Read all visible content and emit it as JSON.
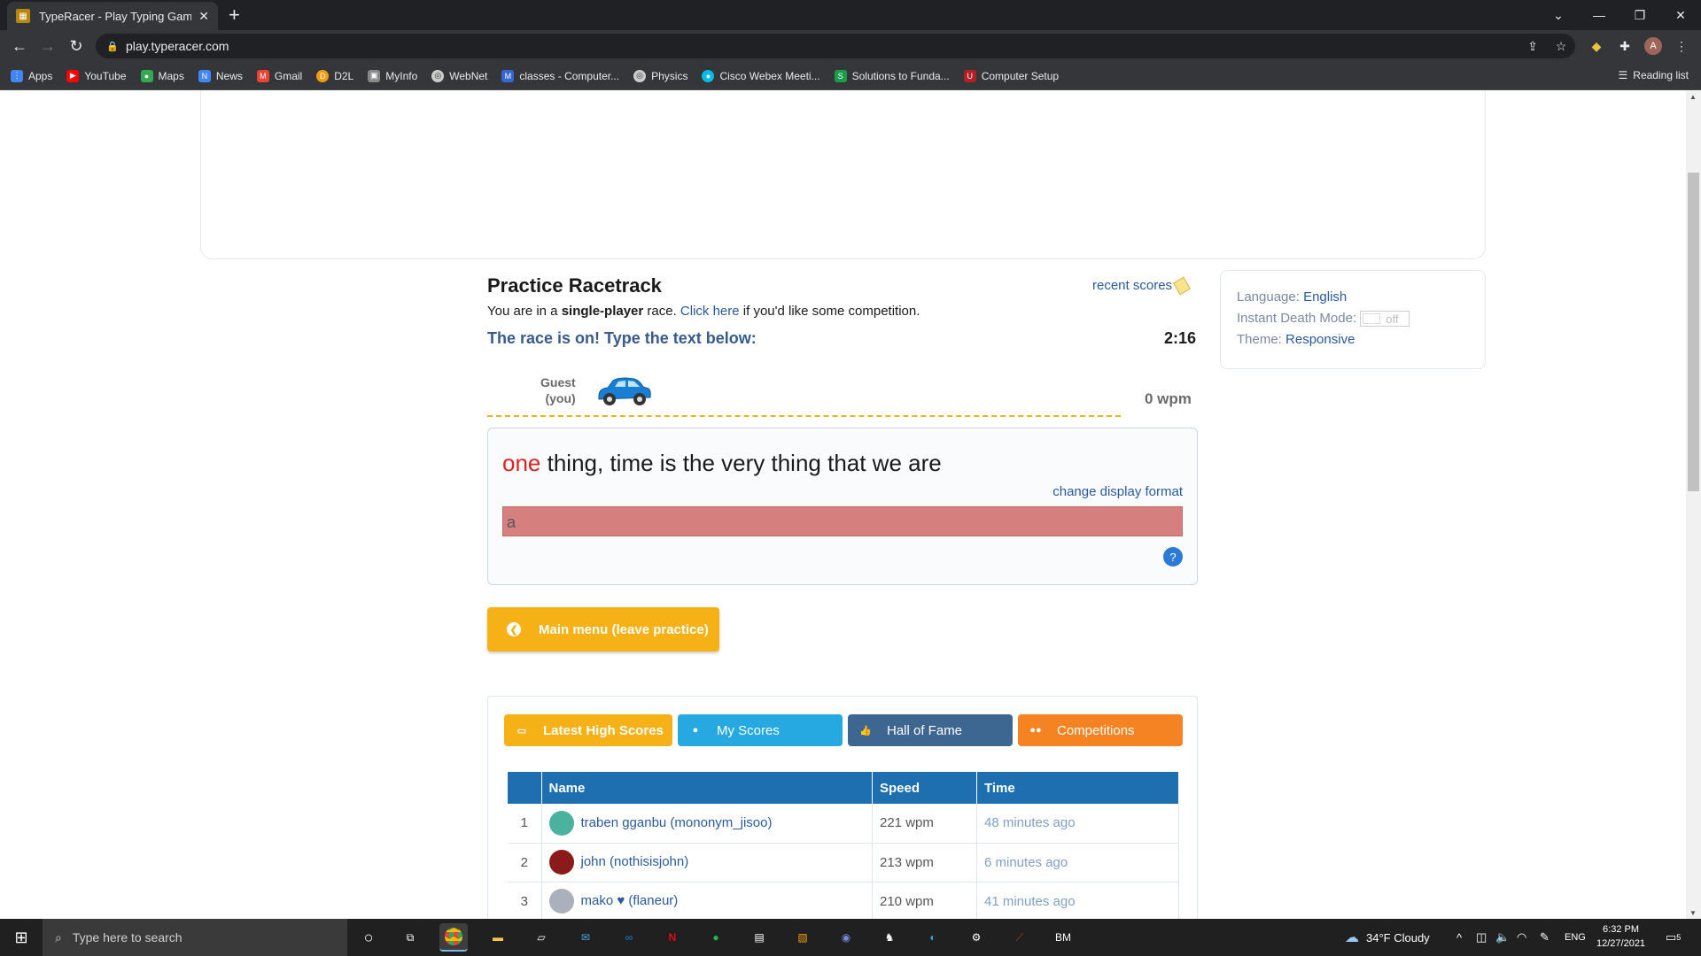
{
  "browser": {
    "tab_title": "TypeRacer - Play Typing Games a",
    "url": "play.typeracer.com",
    "bookmarks": [
      {
        "label": "Apps",
        "icon": "apps-grid-icon",
        "color": "#4285f4"
      },
      {
        "label": "YouTube",
        "icon": "youtube-icon",
        "color": "#ff0000"
      },
      {
        "label": "Maps",
        "icon": "maps-pin-icon",
        "color": "#34a853"
      },
      {
        "label": "News",
        "icon": "news-icon",
        "color": "#4285f4"
      },
      {
        "label": "Gmail",
        "icon": "gmail-icon",
        "color": "#ea4335"
      },
      {
        "label": "D2L",
        "icon": "d2l-icon",
        "color": "#f39c12"
      },
      {
        "label": "MyInfo",
        "icon": "myinfo-icon",
        "color": "#888888"
      },
      {
        "label": "WebNet",
        "icon": "webnet-icon",
        "color": "#cccccc"
      },
      {
        "label": "classes - Computer...",
        "icon": "classes-icon",
        "color": "#3367d6"
      },
      {
        "label": "Physics",
        "icon": "physics-icon",
        "color": "#cccccc"
      },
      {
        "label": "Cisco Webex Meeti...",
        "icon": "webex-icon",
        "color": "#00bceb"
      },
      {
        "label": "Solutions to Funda...",
        "icon": "solutions-icon",
        "color": "#1a9d49"
      },
      {
        "label": "Computer Setup",
        "icon": "computer-setup-icon",
        "color": "#b22222"
      }
    ],
    "reading_list": "Reading list"
  },
  "race": {
    "title": "Practice Racetrack",
    "recent_scores": "recent scores",
    "subtitle_pre": "You are in a ",
    "subtitle_bold": "single-player",
    "subtitle_mid": " race. ",
    "subtitle_link": "Click here",
    "subtitle_post": " if you'd like some competition.",
    "status": "The race is on! Type the text below:",
    "timer": "2:16",
    "racer_name": "Guest",
    "racer_sub": "(you)",
    "wpm": "0 wpm",
    "text_error": "one",
    "text_rest": " thing, time is the very thing that we are",
    "change_display": "change display format",
    "input_value": "a",
    "main_menu": "Main menu (leave practice)"
  },
  "settings": {
    "language_label": "Language:",
    "language_value": "English",
    "instant_death_label": "Instant Death Mode:",
    "instant_death_value": "off",
    "theme_label": "Theme:",
    "theme_value": "Responsive"
  },
  "scores": {
    "tabs": [
      "Latest High Scores",
      "My Scores",
      "Hall of Fame",
      "Competitions"
    ],
    "columns": [
      "Name",
      "Speed",
      "Time"
    ],
    "rows": [
      {
        "rank": "1",
        "name": "traben gganbu (mononym_jisoo)",
        "speed": "221 wpm",
        "time": "48 minutes ago"
      },
      {
        "rank": "2",
        "name": "john (nothisisjohn)",
        "speed": "213 wpm",
        "time": "6 minutes ago"
      },
      {
        "rank": "3",
        "name": "mako ♥ (flaneur)",
        "speed": "210 wpm",
        "time": "41 minutes ago"
      }
    ]
  },
  "taskbar": {
    "search_placeholder": "Type here to search",
    "weather": "34°F  Cloudy",
    "lang": "ENG",
    "time": "6:32 PM",
    "date": "12/27/2021",
    "notifications": "5"
  },
  "colors": {
    "accent_orange": "#f6b117",
    "link_blue": "#2a5a9a",
    "error_red": "#e02020",
    "input_error_bg": "#d67f7f"
  }
}
